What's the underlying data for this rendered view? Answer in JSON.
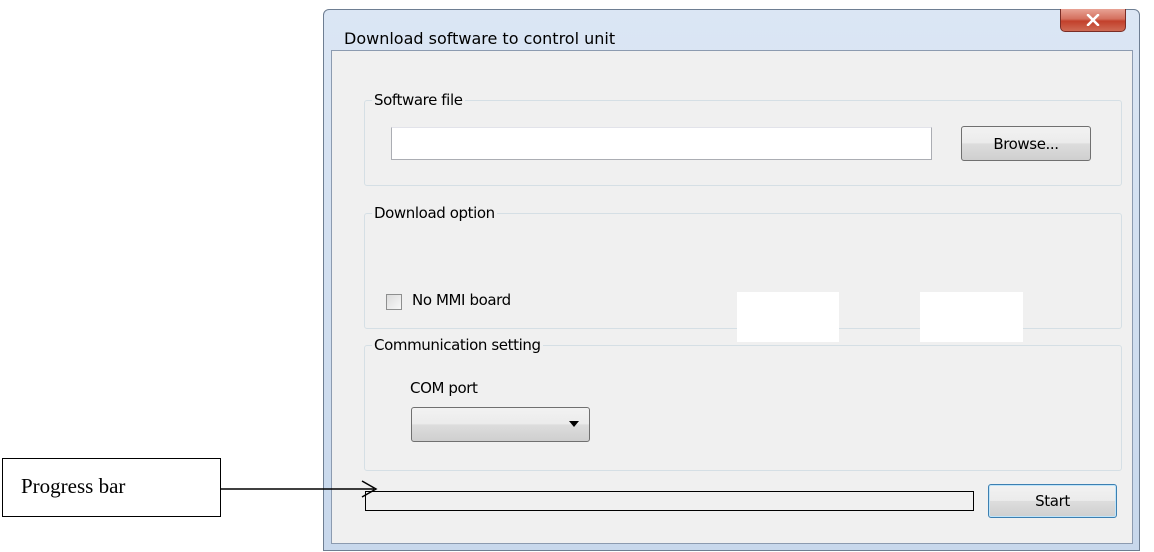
{
  "window": {
    "title": "Download software to control unit",
    "close_icon": "close-x-icon"
  },
  "software_file": {
    "group_label": "Software file",
    "path_value": "",
    "browse_label": "Browse..."
  },
  "download_option": {
    "group_label": "Download option",
    "no_mmi_label": "No MMI board",
    "no_mmi_checked": false
  },
  "communication": {
    "group_label": "Communication setting",
    "com_port_label": "COM port",
    "com_port_selected": "",
    "dropdown_icon": "chevron-down-icon"
  },
  "progress": {
    "value_fraction": 0
  },
  "start_label": "Start",
  "annotation": {
    "label": "Progress bar",
    "arrow_icon": "arrow-right-icon"
  },
  "colors": {
    "close_button": "#c2402b",
    "window_frame": "#c8d8ec",
    "client_background": "#f0f0f0",
    "default_button_border": "#3c7fb1"
  }
}
